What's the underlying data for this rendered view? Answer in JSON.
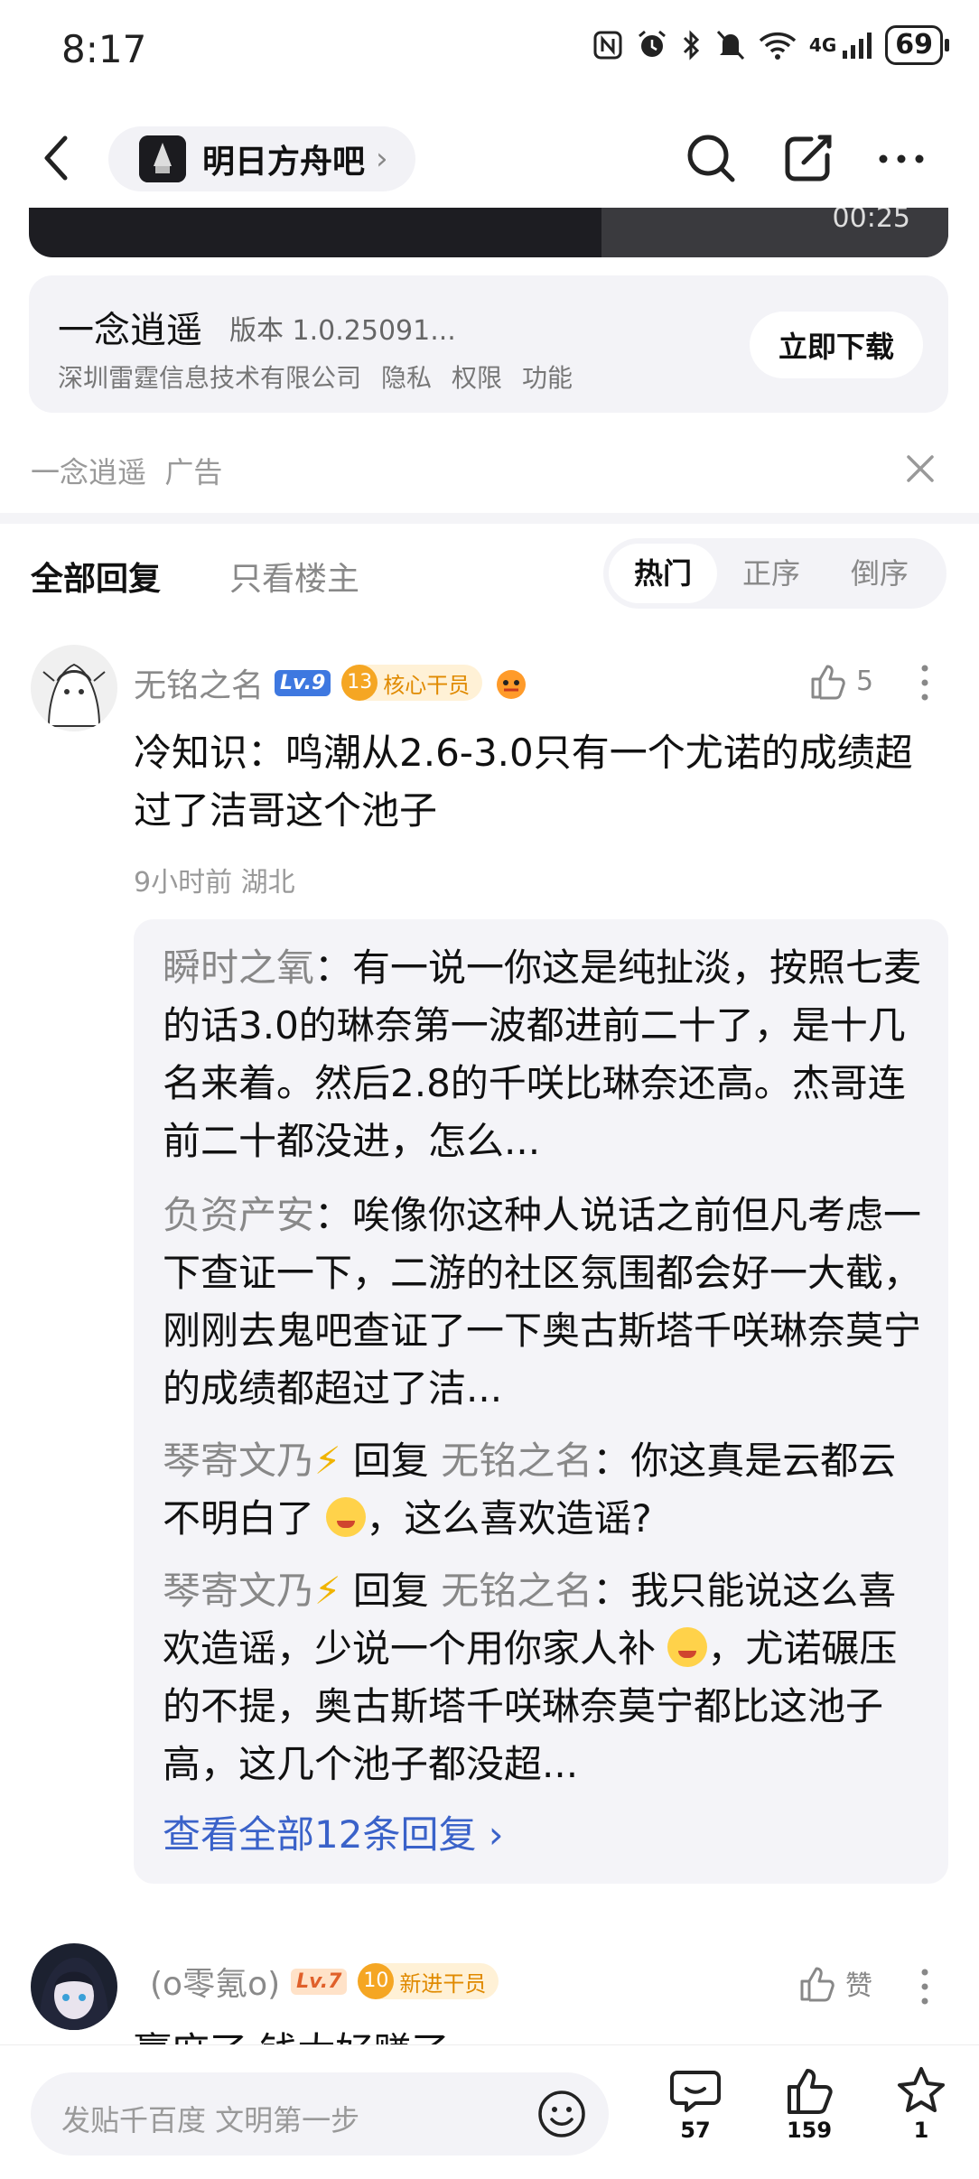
{
  "status_bar": {
    "time": "8:17",
    "network": "4G",
    "battery": "69"
  },
  "header": {
    "forum_name": "明日方舟吧",
    "chevron": "›"
  },
  "video": {
    "duration": "00:25"
  },
  "ad": {
    "app_name": "一念逍遥",
    "version": "版本 1.0.25091...",
    "company": "深圳雷霆信息技术有限公司",
    "links": [
      "隐私",
      "权限",
      "功能"
    ],
    "download_label": "立即下载",
    "source": "一念逍遥",
    "ad_tag": "广告"
  },
  "tabs": {
    "all": "全部回复",
    "owner_only": "只看楼主",
    "sort": [
      "热门",
      "正序",
      "倒序"
    ]
  },
  "comment1": {
    "username": "无铭之名",
    "level": "Lv.9",
    "badge_level": "13",
    "badge_text": "核心干员",
    "likes": "5",
    "text": "冷知识：鸣潮从2.6-3.0只有一个尤诺的成绩超过了洁哥这个池子",
    "time": "9小时前",
    "location": "湖北",
    "replies": [
      {
        "name": "瞬时之氧",
        "text": "：有一说一你这是纯扯淡，按照七麦的话3.0的琳奈第一波都进前二十了，是十几名来着。然后2.8的千咲比琳奈还高。杰哥连前二十都没进，怎么..."
      },
      {
        "name": "负资产安",
        "text": "：唉像你这种人说话之前但凡考虑一下查证一下，二游的社区氛围都会好一大截，刚刚去鬼吧查证了一下奥古斯塔千咲琳奈莫宁的成绩都超过了洁..."
      },
      {
        "name": "琴寄文乃",
        "reply_word": "回复",
        "target": "无铭之名",
        "text_a": "：你这真是云都云不明白了",
        "text_b": "，这么喜欢造谣?"
      },
      {
        "name": "琴寄文乃",
        "reply_word": "回复",
        "target": "无铭之名",
        "text_a": "：我只能说这么喜欢造谣，少说一个用你家人补",
        "text_b": "，尤诺碾压的不提，奥古斯塔千咲琳奈莫宁都比这池子高，这几个池子都没超..."
      }
    ],
    "view_all": "查看全部12条回复 ›"
  },
  "comment2": {
    "username": "(o零氪o)",
    "level": "Lv.7",
    "badge_level": "10",
    "badge_text": "新进干员",
    "like_label": "赞",
    "text_partial": "赢麻了 钱太好赚了"
  },
  "bottom_bar": {
    "placeholder": "发贴千百度 文明第一步",
    "comments": "57",
    "likes": "159",
    "favorites": "1"
  },
  "colors": {
    "accent_blue": "#3a62c9",
    "level_blue": "#3e78e0",
    "badge_orange": "#f5a623"
  }
}
